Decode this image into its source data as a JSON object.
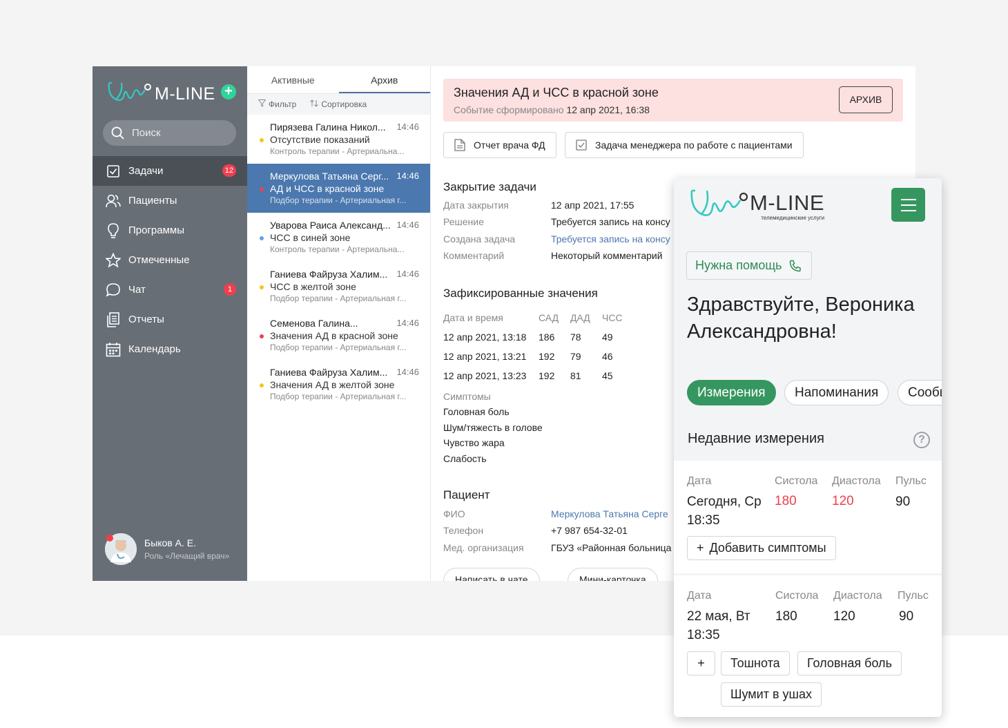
{
  "app": {
    "brand": "M-LINE",
    "search_placeholder": "Поиск",
    "nav": [
      {
        "label": "Задачи",
        "badge": "12",
        "icon": "task-check-icon"
      },
      {
        "label": "Пациенты",
        "badge": "",
        "icon": "users-icon"
      },
      {
        "label": "Программы",
        "badge": "",
        "icon": "lightbulb-icon"
      },
      {
        "label": "Отмеченные",
        "badge": "",
        "icon": "star-icon"
      },
      {
        "label": "Чат",
        "badge": "1",
        "icon": "chat-icon"
      },
      {
        "label": "Отчеты",
        "badge": "",
        "icon": "report-icon"
      },
      {
        "label": "Календарь",
        "badge": "",
        "icon": "calendar-icon"
      }
    ],
    "user": {
      "name": "Быков А. Е.",
      "role": "Роль «Лечащий врач»"
    }
  },
  "list": {
    "tabs": [
      "Активные",
      "Архив"
    ],
    "filter_label": "Фильтр",
    "sort_label": "Сортировка",
    "items": [
      {
        "name": "Пирязева Галина Никол...",
        "time": "14:46",
        "status": "Отсутствие показаний",
        "sub": "Контроль терапии - Артериальна...",
        "dot": "#f5c518"
      },
      {
        "name": "Меркулова Татьяна Серг...",
        "time": "14:46",
        "status": "АД и ЧСС в красной зоне",
        "sub": "Подбор терапии - Артериальная г...",
        "dot": "#ef3f4e"
      },
      {
        "name": "Уварова Раиса Александ...",
        "time": "14:46",
        "status": "ЧСС в синей зоне",
        "sub": "Контроль терапии - Артериальна...",
        "dot": "#6a9ce8"
      },
      {
        "name": "Ганиева Файруза Халим...",
        "time": "14:46",
        "status": "ЧСС в желтой зоне",
        "sub": "Подбор терапии - Артериальная г...",
        "dot": "#f5c518"
      },
      {
        "name": "Семенова Галина...",
        "time": "14:46",
        "status": "Значения АД в красной зоне",
        "sub": "Подбор терапии - Артериальная г...",
        "dot": "#ef3f4e"
      },
      {
        "name": "Ганиева Файруза Халим...",
        "time": "14:46",
        "status": "Значения АД в желтой зоне",
        "sub": "Подбор терапии - Артериальная г...",
        "dot": "#f5c518"
      }
    ]
  },
  "detail": {
    "alert_title": "Значения АД и ЧСС в красной зоне",
    "alert_sub_label": "Событие сформировано",
    "alert_sub_value": "12 апр 2021, 16:38",
    "archive_button": "АРХИВ",
    "doc_buttons": [
      "Отчет врача ФД",
      "Задача менеджера по работе с пациентами"
    ],
    "closing_title": "Закрытие задачи",
    "closing": [
      {
        "k": "Дата закрытия",
        "v": "12 апр 2021, 17:55"
      },
      {
        "k": "Решение",
        "v": "Требуется запись на консу"
      },
      {
        "k": "Создана задача",
        "v": "Требуется запись на консу"
      },
      {
        "k": "Комментарий",
        "v": "Некоторый комментарий"
      }
    ],
    "values_title": "Зафиксированные значения",
    "values_headers": [
      "Дата и время",
      "САД",
      "ДАД",
      "ЧСС"
    ],
    "values_rows": [
      [
        "12 апр 2021, 13:18",
        "186",
        "78",
        "49"
      ],
      [
        "12 апр 2021, 13:21",
        "192",
        "79",
        "46"
      ],
      [
        "12 апр 2021, 13:23",
        "192",
        "81",
        "45"
      ]
    ],
    "symptoms_title": "Симптомы",
    "symptoms": [
      "Головная боль",
      "Шум/тяжесть в голове",
      "Чувство жара",
      "Слабость"
    ],
    "patient_title": "Пациент",
    "patient": [
      {
        "k": "ФИО",
        "v": "Меркулова Татьяна Серге"
      },
      {
        "k": "Телефон",
        "v": "+7 987 654-32-01"
      },
      {
        "k": "Мед. организация",
        "v": "ГБУЗ «Районная больница"
      }
    ],
    "bottom_buttons": [
      "Написать в чате",
      "Мини-карточка"
    ]
  },
  "mobile": {
    "brand": "M-LINE",
    "brand_sub": "телемедицинские услуги",
    "help_button": "Нужна помощь",
    "greeting": "Здравствуйте, Вероника Александровна!",
    "tabs": [
      "Измерения",
      "Напоминания",
      "Сообщения"
    ],
    "recent_title": "Недавние измерения",
    "headers": [
      "Дата",
      "Систола",
      "Диастола",
      "Пульс"
    ],
    "measurements": [
      {
        "date1": "Сегодня, Ср",
        "date2": "18:35",
        "sys": "180",
        "dia": "120",
        "pulse": "90",
        "alert": true
      },
      {
        "date1": "22 мая, Вт",
        "date2": "18:35",
        "sys": "180",
        "dia": "120",
        "pulse": "90",
        "alert": false
      }
    ],
    "add_symptoms": "Добавить симптомы",
    "symptom_chips": [
      "Тошнота",
      "Головная боль",
      "Шумит в ушах"
    ]
  },
  "colors": {
    "sidebar": "#686e76",
    "accent_blue": "#4b78af",
    "accent_green": "#36965f",
    "alert_bg": "#fde0e0",
    "red": "#ef3f4e"
  }
}
